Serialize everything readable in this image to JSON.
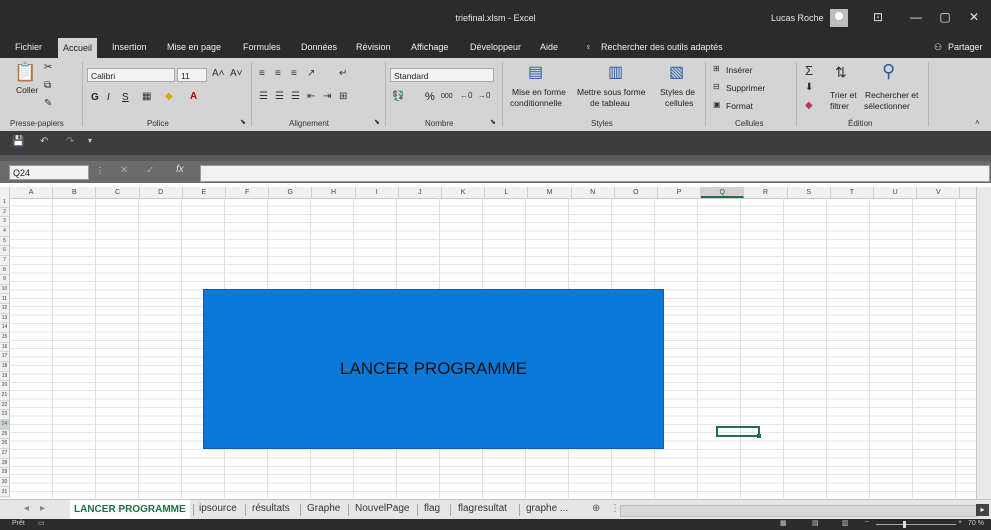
{
  "window": {
    "title": "triefinal.xlsm  -  Excel",
    "user": "Lucas Roche"
  },
  "tabs": [
    "Fichier",
    "Accueil",
    "Insertion",
    "Mise en page",
    "Formules",
    "Données",
    "Révision",
    "Affichage",
    "Développeur",
    "Aide"
  ],
  "tell_me": "Rechercher des outils adaptés",
  "share": "Partager",
  "ribbon": {
    "clipboard": {
      "paste": "Coller",
      "label": "Presse-papiers"
    },
    "font": {
      "name": "Calibri",
      "size": "11",
      "bold": "G",
      "italic": "I",
      "underline": "S",
      "label": "Police"
    },
    "alignment": {
      "label": "Alignement"
    },
    "number": {
      "format": "Standard",
      "percent": "%",
      "thousands": "000",
      "label": "Nombre"
    },
    "styles": {
      "conditional1": "Mise en forme",
      "conditional2": "conditionnelle",
      "table1": "Mettre sous forme",
      "table2": "de tableau",
      "cell1": "Styles de",
      "cell2": "cellules",
      "label": "Styles"
    },
    "cells": {
      "insert": "Insérer",
      "delete": "Supprimer",
      "format": "Format",
      "label": "Cellules"
    },
    "editing": {
      "sort1": "Trier et",
      "sort2": "filtrer",
      "find1": "Rechercher et",
      "find2": "sélectionner",
      "label": "Édition"
    }
  },
  "namebox": "Q24",
  "fx": "fx",
  "columns": [
    "A",
    "B",
    "C",
    "D",
    "E",
    "F",
    "G",
    "H",
    "I",
    "J",
    "K",
    "L",
    "M",
    "N",
    "O",
    "P",
    "Q",
    "R",
    "S",
    "T",
    "U",
    "V"
  ],
  "rows": [
    "1",
    "2",
    "3",
    "4",
    "5",
    "6",
    "7",
    "8",
    "9",
    "10",
    "11",
    "12",
    "13",
    "14",
    "15",
    "16",
    "17",
    "18",
    "19",
    "20",
    "21",
    "22",
    "23",
    "24",
    "25",
    "26",
    "27",
    "28",
    "29",
    "30",
    "31"
  ],
  "button_label": "LANCER PROGRAMME",
  "sheets": [
    "LANCER PROGRAMME",
    "ipsource",
    "résultats",
    "Graphe",
    "NouvelPage",
    "flag",
    "flagresultat",
    "graphe ..."
  ],
  "status": {
    "ready": "Prêt",
    "zoom": "70 %"
  }
}
